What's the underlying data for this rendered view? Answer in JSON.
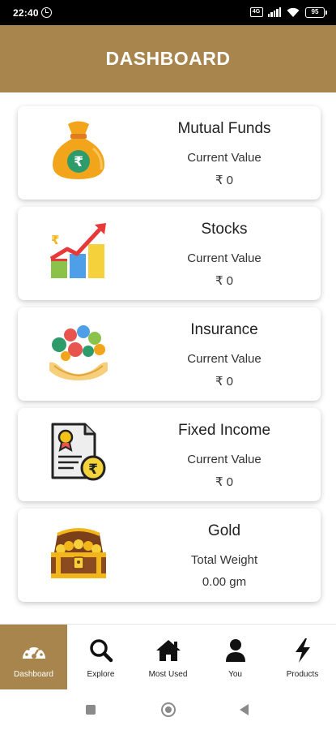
{
  "status_bar": {
    "time": "22:40",
    "sim_label": "4G",
    "battery_level": "95"
  },
  "header": {
    "title": "DASHBOARD"
  },
  "cards": [
    {
      "title": "Mutual Funds",
      "label": "Current Value",
      "value": "₹ 0",
      "icon": "money-bag-icon"
    },
    {
      "title": "Stocks",
      "label": "Current Value",
      "value": "₹ 0",
      "icon": "bar-chart-growth-icon"
    },
    {
      "title": "Insurance",
      "label": "Current Value",
      "value": "₹ 0",
      "icon": "insurance-hands-icon"
    },
    {
      "title": "Fixed Income",
      "label": "Current Value",
      "value": "₹ 0",
      "icon": "certificate-icon"
    },
    {
      "title": "Gold",
      "label": "Total Weight",
      "value": "0.00 gm",
      "icon": "treasure-chest-icon"
    }
  ],
  "bottom_nav": {
    "items": [
      {
        "label": "Dashboard",
        "icon": "speedometer-icon",
        "active": true
      },
      {
        "label": "Explore",
        "icon": "search-icon",
        "active": false
      },
      {
        "label": "Most Used",
        "icon": "home-icon",
        "active": false
      },
      {
        "label": "You",
        "icon": "person-icon",
        "active": false
      },
      {
        "label": "Products",
        "icon": "lightning-icon",
        "active": false
      }
    ]
  },
  "colors": {
    "brand": "#a8854d",
    "card_background": "#ffffff",
    "status_bar": "#000000"
  }
}
